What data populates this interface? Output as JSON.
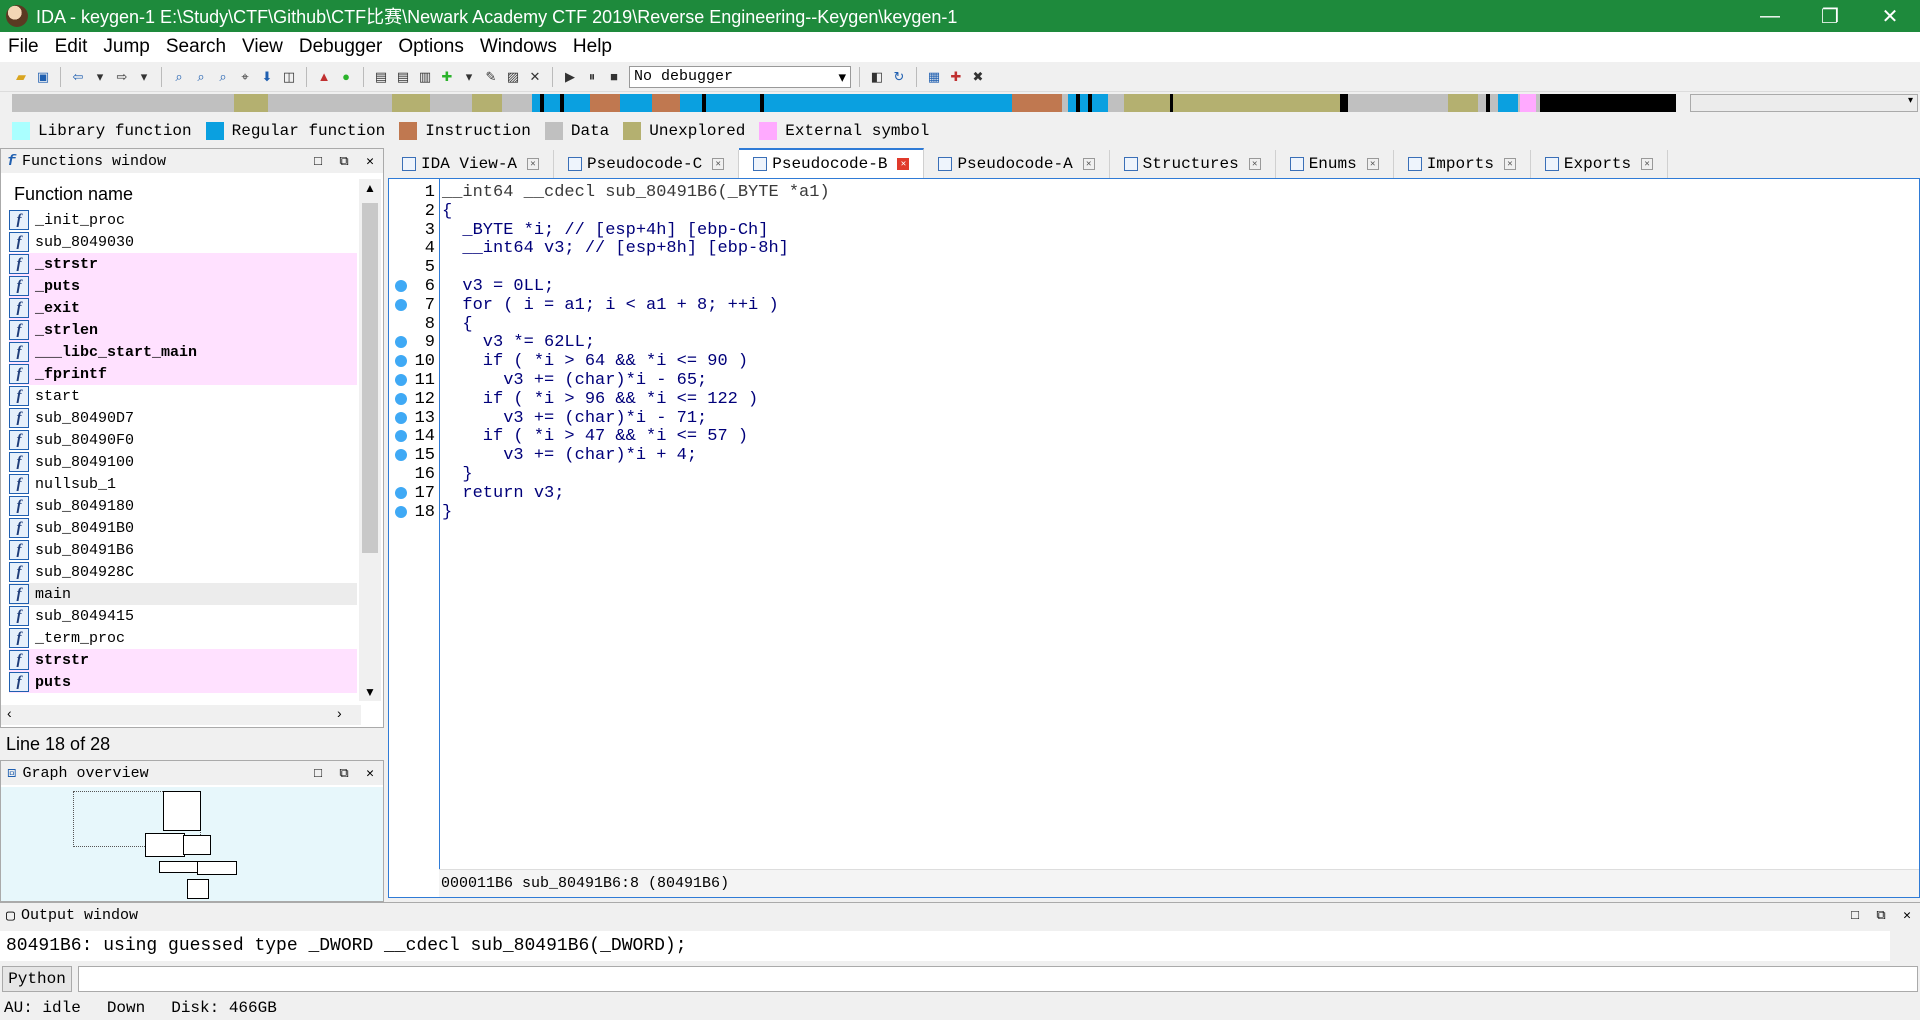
{
  "window": {
    "title": "IDA - keygen-1 E:\\Study\\CTF\\Github\\CTF比赛\\Newark Academy CTF 2019\\Reverse Engineering--Keygen\\keygen-1",
    "minimize": "—",
    "maximize": "❐",
    "close": "✕"
  },
  "menu": [
    "File",
    "Edit",
    "Jump",
    "Search",
    "View",
    "Debugger",
    "Options",
    "Windows",
    "Help"
  ],
  "toolbar": {
    "debugger_value": "No debugger"
  },
  "legend": [
    {
      "label": "Library function",
      "color": "#aaffff"
    },
    {
      "label": "Regular function",
      "color": "#0aa0e0"
    },
    {
      "label": "Instruction",
      "color": "#c07850"
    },
    {
      "label": "Data",
      "color": "#c0c0c0"
    },
    {
      "label": "Unexplored",
      "color": "#b4b070"
    },
    {
      "label": "External symbol",
      "color": "#ffaaff"
    }
  ],
  "functions_window": {
    "title": "Functions window",
    "column_header": "Function name",
    "items": [
      {
        "name": "_init_proc",
        "lib": false
      },
      {
        "name": "sub_8049030",
        "lib": false
      },
      {
        "name": "_strstr",
        "lib": true
      },
      {
        "name": "_puts",
        "lib": true
      },
      {
        "name": "_exit",
        "lib": true
      },
      {
        "name": "_strlen",
        "lib": true
      },
      {
        "name": "___libc_start_main",
        "lib": true
      },
      {
        "name": "_fprintf",
        "lib": true
      },
      {
        "name": "start",
        "lib": false
      },
      {
        "name": "sub_80490D7",
        "lib": false
      },
      {
        "name": "sub_80490F0",
        "lib": false
      },
      {
        "name": "sub_8049100",
        "lib": false
      },
      {
        "name": "nullsub_1",
        "lib": false
      },
      {
        "name": "sub_8049180",
        "lib": false
      },
      {
        "name": "sub_80491B0",
        "lib": false
      },
      {
        "name": "sub_80491B6",
        "lib": false
      },
      {
        "name": "sub_804928C",
        "lib": false
      },
      {
        "name": "main",
        "lib": false,
        "selected": true
      },
      {
        "name": "sub_8049415",
        "lib": false
      },
      {
        "name": "_term_proc",
        "lib": false
      },
      {
        "name": "strstr",
        "lib": true
      },
      {
        "name": "puts",
        "lib": true
      }
    ],
    "line_status": "Line 18 of 28"
  },
  "graph_overview": {
    "title": "Graph overview"
  },
  "tabs": [
    {
      "label": "IDA View-A",
      "active": false
    },
    {
      "label": "Pseudocode-C",
      "active": false
    },
    {
      "label": "Pseudocode-B",
      "active": true
    },
    {
      "label": "Pseudocode-A",
      "active": false
    },
    {
      "label": "Structures",
      "active": false
    },
    {
      "label": "Enums",
      "active": false
    },
    {
      "label": "Imports",
      "active": false
    },
    {
      "label": "Exports",
      "active": false
    }
  ],
  "code": {
    "lines": [
      {
        "n": "1",
        "bp": false,
        "text": "__int64 __cdecl sub_80491B6(_BYTE *a1)"
      },
      {
        "n": "2",
        "bp": false,
        "text": "{"
      },
      {
        "n": "3",
        "bp": false,
        "text": "  _BYTE *i; // [esp+4h] [ebp-Ch]"
      },
      {
        "n": "4",
        "bp": false,
        "text": "  __int64 v3; // [esp+8h] [ebp-8h]"
      },
      {
        "n": "5",
        "bp": false,
        "text": ""
      },
      {
        "n": "6",
        "bp": true,
        "text": "  v3 = 0LL;"
      },
      {
        "n": "7",
        "bp": true,
        "text": "  for ( i = a1; i < a1 + 8; ++i )"
      },
      {
        "n": "8",
        "bp": false,
        "text": "  {"
      },
      {
        "n": "9",
        "bp": true,
        "text": "    v3 *= 62LL;"
      },
      {
        "n": "10",
        "bp": true,
        "text": "    if ( *i > 64 && *i <= 90 )"
      },
      {
        "n": "11",
        "bp": true,
        "text": "      v3 += (char)*i - 65;"
      },
      {
        "n": "12",
        "bp": true,
        "text": "    if ( *i > 96 && *i <= 122 )"
      },
      {
        "n": "13",
        "bp": true,
        "text": "      v3 += (char)*i - 71;"
      },
      {
        "n": "14",
        "bp": true,
        "text": "    if ( *i > 47 && *i <= 57 )"
      },
      {
        "n": "15",
        "bp": true,
        "text": "      v3 += (char)*i + 4;"
      },
      {
        "n": "16",
        "bp": false,
        "text": "  }"
      },
      {
        "n": "17",
        "bp": true,
        "text": "  return v3;"
      },
      {
        "n": "18",
        "bp": true,
        "text": "}"
      }
    ],
    "status_offset": "000011B6",
    "status_location": "sub_80491B6:8 (80491B6)"
  },
  "output_window": {
    "title": "Output window",
    "text": "80491B6: using guessed type _DWORD __cdecl sub_80491B6(_DWORD);",
    "python_label": "Python"
  },
  "statusbar": {
    "au": "AU:  idle",
    "direction": "Down",
    "disk": "Disk: 466GB"
  },
  "colors": {
    "titlebar": "#1e8a3c",
    "accent": "#2f7bd6",
    "library_bg": "#ffe1ff"
  }
}
